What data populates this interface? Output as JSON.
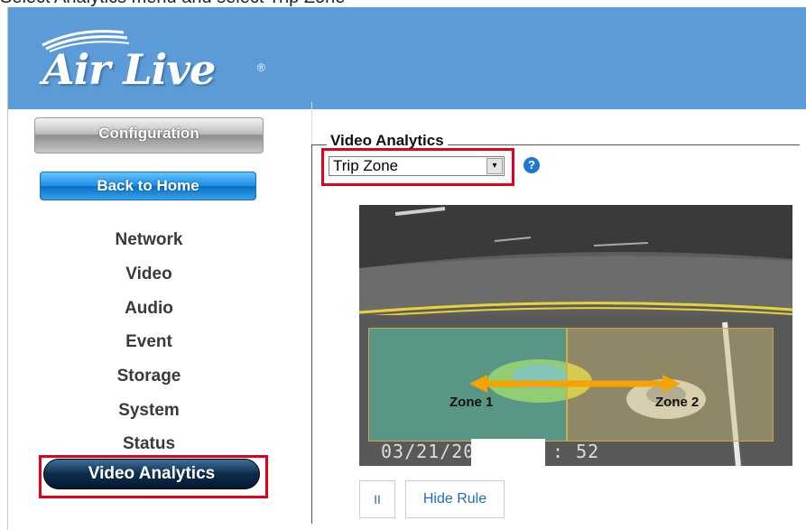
{
  "caption": "Select Analytics menu and select Trip Zone",
  "brand": {
    "name": "Air Live",
    "registered": "®",
    "header_color": "#5b9bd8"
  },
  "sidebar": {
    "config_label": "Configuration",
    "home_label": "Back to Home",
    "items": [
      {
        "label": "Network"
      },
      {
        "label": "Video"
      },
      {
        "label": "Audio"
      },
      {
        "label": "Event"
      },
      {
        "label": "Storage"
      },
      {
        "label": "System"
      },
      {
        "label": "Status"
      }
    ],
    "active_label": "Video Analytics"
  },
  "main": {
    "section_title": "Video Analytics",
    "mode_select": {
      "value": "Trip Zone",
      "arrow": "▾"
    },
    "help_icon": "?",
    "video": {
      "zone1_label": "Zone 1",
      "zone2_label": "Zone 2",
      "timestamp_left": "03/21/20",
      "timestamp_right": ": 52"
    },
    "pause_icon": "II",
    "hide_rule_label": "Hide Rule"
  },
  "colors": {
    "highlight": "#e3001b",
    "link_blue": "#1a6fc2",
    "zone1": "#5ac8aa",
    "zone2": "#d2be78"
  }
}
